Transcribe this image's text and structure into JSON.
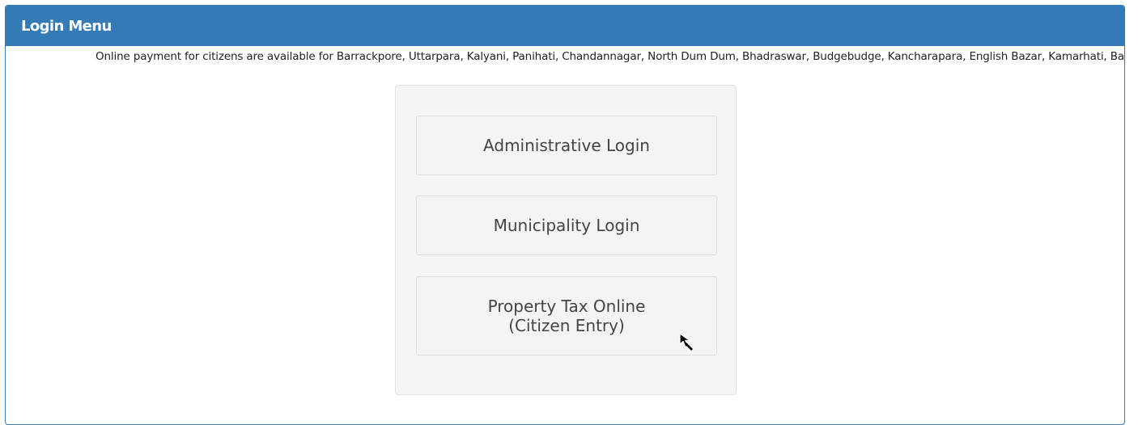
{
  "panel": {
    "title": "Login Menu"
  },
  "notice": {
    "text": "Online payment for citizens are available for Barrackpore, Uttarpara, Kalyani, Panihati, Chandannagar, North Dum Dum, Bhadraswar, Budgebudge, Kancharapara, English Bazar, Kamarhati, Baranagar, Naihati, Halisahar"
  },
  "menu": {
    "admin_login": "Administrative Login",
    "municipality_login": "Municipality Login",
    "property_tax_line1": "Property Tax Online",
    "property_tax_line2": "(Citizen Entry)"
  },
  "colors": {
    "header_bg": "#337ab7",
    "header_text": "#ffffff",
    "well_bg": "#f5f5f5"
  },
  "icons": {
    "cursor": "mouse-pointer-icon"
  }
}
